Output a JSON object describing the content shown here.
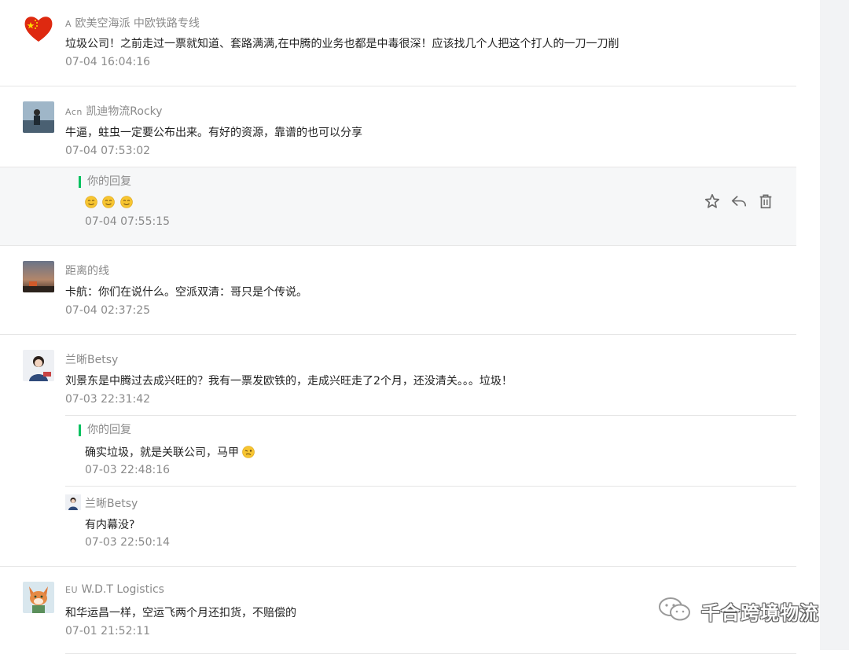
{
  "comments": [
    {
      "nick_tag": "A",
      "nick": "欧美空海派 中欧铁路专线",
      "text": "垃圾公司！之前走过一票就知道、套路满满,在中腾的业务也都是中毒很深！应该找几个人把这个打人的一刀一刀削",
      "time": "07-04 16:04:16",
      "avatar_icon": "heart-flag-icon"
    },
    {
      "nick_tag": "Acn",
      "nick": "凯迪物流Rocky",
      "text": "牛逼，蛀虫一定要公布出来。有好的资源，靠谱的也可以分享",
      "time": "07-04 07:53:02",
      "avatar_icon": "person-seaside-avatar",
      "reply": {
        "label": "你的回复",
        "time": "07-04 07:55:15",
        "emoji_icon": "smile-emoji-icon"
      }
    },
    {
      "nick": "距离的线",
      "text": "卡航：你们在说什么。空派双清：哥只是个传说。",
      "time": "07-04 02:37:25",
      "avatar_icon": "dusk-landscape-avatar"
    },
    {
      "nick": "兰晰Betsy",
      "text": "刘景东是中腾过去成兴旺的？我有一票发欧铁的，走成兴旺走了2个月，还没清关。。。垃圾！",
      "time": "07-03 22:31:42",
      "avatar_icon": "woman-portrait-avatar",
      "reply": {
        "label": "你的回复",
        "text": "确实垃圾，就是关联公司，马甲",
        "time": "07-03 22:48:16",
        "emoji_icon": "woozy-emoji-icon"
      },
      "sub": {
        "nick": "兰晰Betsy",
        "text": "有内幕没?",
        "time": "07-03 22:50:14"
      }
    },
    {
      "nick_tag": "EU",
      "nick": "W.D.T Logistics",
      "text": "和华运昌一样，空运飞两个月还扣货，不赔偿的",
      "time": "07-01 21:52:11",
      "avatar_icon": "fox-avatar"
    }
  ],
  "actions": {
    "star": "star-icon",
    "reply": "reply-icon",
    "delete": "trash-icon"
  },
  "watermark": {
    "text": "千合跨境物流",
    "icon": "wechat-icon"
  },
  "colors": {
    "accent": "#07c160",
    "meta": "#8a8a8a",
    "text": "#222222",
    "divider": "#e6e6e6",
    "highlight_bg": "#f6f7f8"
  }
}
